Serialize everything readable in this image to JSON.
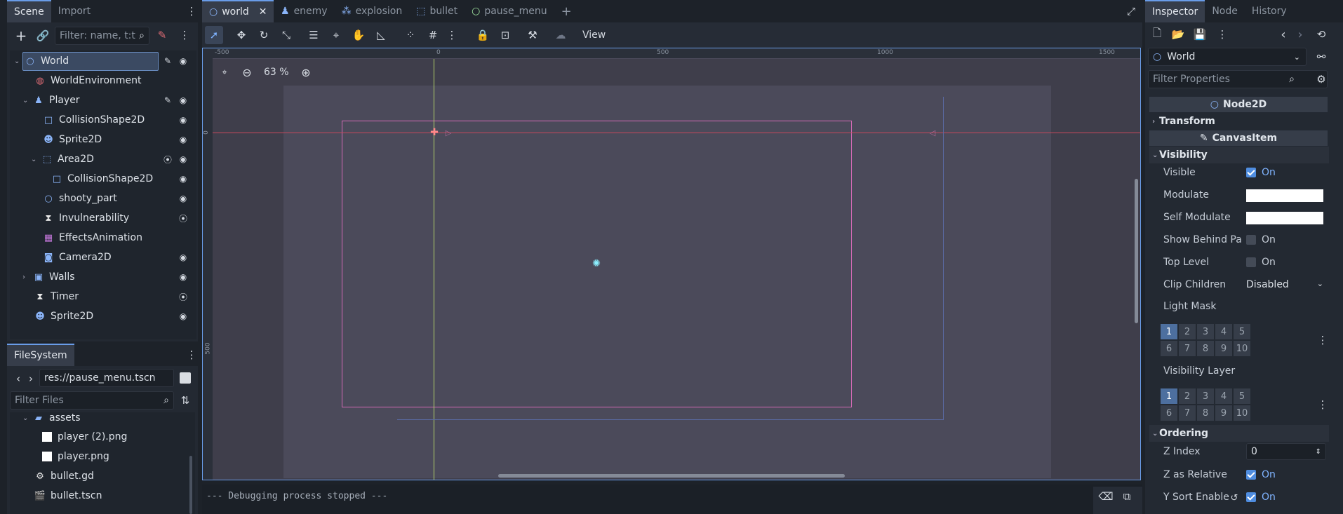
{
  "left_tabs": {
    "scene": "Scene",
    "import": "Import"
  },
  "scene_filter_placeholder": "Filter: name, t:t",
  "tree": [
    {
      "label": "World",
      "icon": "node2d-icon",
      "glyph": "○"
    },
    {
      "label": "WorldEnvironment",
      "icon": "globe-icon",
      "glyph": "🌐"
    },
    {
      "label": "Player",
      "icon": "characterbody-icon",
      "glyph": "♟"
    },
    {
      "label": "CollisionShape2D",
      "icon": "collision-shape-icon",
      "glyph": "□"
    },
    {
      "label": "Sprite2D",
      "icon": "sprite-icon",
      "glyph": "☻"
    },
    {
      "label": "Area2D",
      "icon": "area2d-icon",
      "glyph": "⬚"
    },
    {
      "label": "CollisionShape2D",
      "icon": "collision-shape-icon",
      "glyph": "□"
    },
    {
      "label": "shooty_part",
      "icon": "node2d-icon",
      "glyph": "○"
    },
    {
      "label": "Invulnerability",
      "icon": "timer-icon",
      "glyph": "⧗"
    },
    {
      "label": "EffectsAnimation",
      "icon": "animation-player-icon",
      "glyph": "▦"
    },
    {
      "label": "Camera2D",
      "icon": "camera-icon",
      "glyph": "◙"
    },
    {
      "label": "Walls",
      "icon": "staticbody-icon",
      "glyph": "▣"
    },
    {
      "label": "Timer",
      "icon": "timer-icon",
      "glyph": "⧗"
    },
    {
      "label": "Sprite2D",
      "icon": "sprite-icon",
      "glyph": "☻"
    }
  ],
  "filesystem": {
    "tab": "FileSystem",
    "path": "res://pause_menu.tscn",
    "filter_placeholder": "Filter Files",
    "items": [
      {
        "label": "assets",
        "icon": "folder-icon"
      },
      {
        "label": "player (2).png",
        "icon": "image-file-icon"
      },
      {
        "label": "player.png",
        "icon": "image-file-icon"
      },
      {
        "label": "bullet.gd",
        "icon": "script-file-icon"
      },
      {
        "label": "bullet.tscn",
        "icon": "scene-file-icon"
      }
    ]
  },
  "editor_tabs": [
    "world",
    "enemy",
    "explosion",
    "bullet",
    "pause_menu"
  ],
  "toolbar": {
    "view": "View"
  },
  "zoom": "63 %",
  "ruler": {
    "h": [
      "-500",
      "0",
      "500",
      "1000",
      "1500"
    ],
    "v": [
      "0",
      "500"
    ]
  },
  "output": "--- Debugging process stopped ---",
  "inspector": {
    "tabs": {
      "inspector": "Inspector",
      "node": "Node",
      "history": "History"
    },
    "object": "World",
    "filter_placeholder": "Filter Properties",
    "class_header": "Node2D",
    "transform": "Transform",
    "canvas_item": "CanvasItem",
    "visibility": "Visibility",
    "props": {
      "visible": "Visible",
      "visible_val": "On",
      "modulate": "Modulate",
      "self_modulate": "Self Modulate",
      "show_behind": "Show Behind Pa",
      "show_behind_val": "On",
      "top_level": "Top Level",
      "top_level_val": "On",
      "clip_children": "Clip Children",
      "clip_children_val": "Disabled",
      "light_mask": "Light Mask",
      "visibility_layer": "Visibility Layer"
    },
    "layers": [
      "1",
      "2",
      "3",
      "4",
      "5",
      "6",
      "7",
      "8",
      "9",
      "10"
    ],
    "ordering": "Ordering",
    "z_index": "Z Index",
    "z_index_val": "0",
    "z_relative": "Z as Relative",
    "z_relative_val": "On",
    "y_sort": "Y Sort Enable",
    "y_sort_val": "On"
  },
  "colors": {
    "accent": "#699ce8",
    "viewport_bg": "#4b4a5a"
  }
}
